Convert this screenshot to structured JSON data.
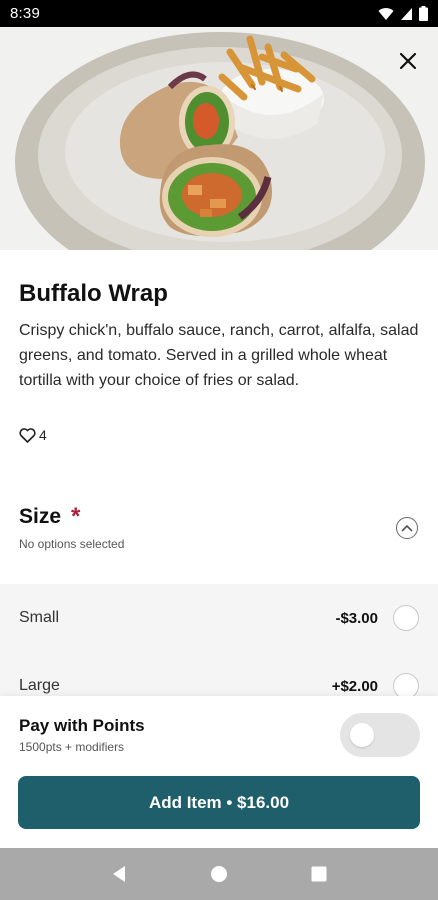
{
  "status_bar": {
    "time": "8:39"
  },
  "item": {
    "title": "Buffalo Wrap",
    "description": "Crispy chick'n, buffalo sauce, ranch, carrot, alfalfa, salad greens, and tomato. Served in a grilled whole wheat tortilla with your choice of fries or salad.",
    "likes": "4"
  },
  "size_section": {
    "title": "Size",
    "required_mark": "*",
    "subtitle": "No options selected",
    "options": [
      {
        "label": "Small",
        "price": "-$3.00"
      },
      {
        "label": "Large",
        "price": "+$2.00"
      }
    ]
  },
  "points": {
    "title": "Pay with Points",
    "subtitle": "1500pts + modifiers",
    "enabled": false
  },
  "add_button": {
    "label": "Add Item • $16.00"
  },
  "colors": {
    "accent": "#1f5f6b",
    "required": "#b0203a"
  },
  "icons": [
    "wifi-icon",
    "cell-signal-icon",
    "battery-icon",
    "close-icon",
    "heart-icon",
    "chevron-up-icon",
    "back-icon",
    "home-icon",
    "recents-icon"
  ]
}
